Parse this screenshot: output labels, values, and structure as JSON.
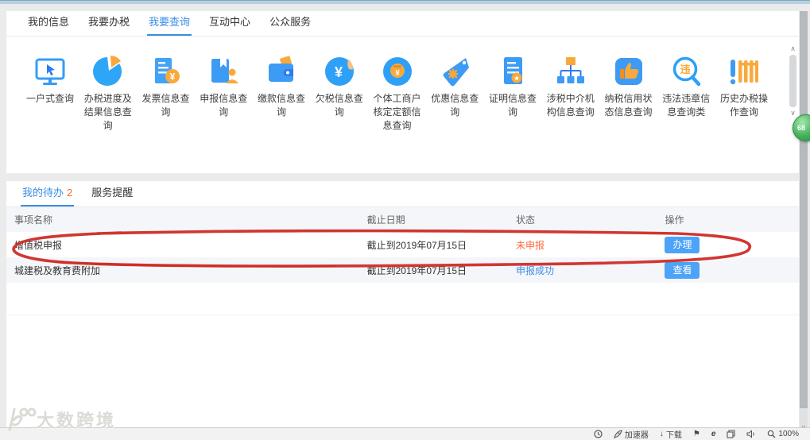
{
  "nav": {
    "tabs": [
      {
        "label": "我的信息"
      },
      {
        "label": "我要办税"
      },
      {
        "label": "我要查询"
      },
      {
        "label": "互动中心"
      },
      {
        "label": "公众服务"
      }
    ],
    "active_tab": "我要查询",
    "active_color": "#3a8ee6"
  },
  "query_icons": {
    "items": [
      {
        "label": "一户式查询",
        "icon": "monitor-cursor-icon"
      },
      {
        "label": "办税进度及结果信息查询",
        "icon": "pie-chart-icon"
      },
      {
        "label": "发票信息查询",
        "icon": "invoice-coin-icon"
      },
      {
        "label": "申报信息查询",
        "icon": "book-person-icon"
      },
      {
        "label": "缴款信息查询",
        "icon": "wallet-icon"
      },
      {
        "label": "欠税信息查询",
        "icon": "yuan-circle-icon"
      },
      {
        "label": "个体工商户核定定额信息查询",
        "icon": "coin-slot-icon"
      },
      {
        "label": "优惠信息查询",
        "icon": "discount-tag-icon"
      },
      {
        "label": "证明信息查询",
        "icon": "certificate-icon"
      },
      {
        "label": "涉税中介机构信息查询",
        "icon": "org-chart-icon"
      },
      {
        "label": "纳税信用状态信息查询",
        "icon": "thumbs-up-icon"
      },
      {
        "label": "违法违章信息查询类",
        "icon": "violation-search-icon"
      },
      {
        "label": "历史办税操作查询",
        "icon": "history-fence-icon"
      }
    ]
  },
  "todo": {
    "tabs": [
      {
        "label": "我的待办",
        "badge": "2"
      },
      {
        "label": "服务提醒",
        "badge": ""
      }
    ],
    "active_tab": "我的待办",
    "table": {
      "headers": [
        "事项名称",
        "截止日期",
        "状态",
        "操作"
      ],
      "rows": [
        {
          "name": "增值税申报",
          "deadline": "截止到2019年07月15日",
          "status": "未申报",
          "status_color": "#ff6c3e",
          "action": "办理"
        },
        {
          "name": "城建税及教育费附加",
          "deadline": "截止到2019年07月15日",
          "status": "申报成功",
          "status_color": "#3a8ee6",
          "action": "查看"
        }
      ]
    }
  },
  "annotation": {
    "shape": "hand-drawn-ellipse",
    "color": "#cf2b26",
    "target_row": "增值税申报"
  },
  "floating_badge": {
    "text": "68",
    "color": "#3fae54"
  },
  "watermark": {
    "text": "大数跨境"
  },
  "statusbar": {
    "accelerator_label": "加速器",
    "download_label": "下载",
    "ie_label": "e",
    "zoom_level": "100%"
  },
  "colors": {
    "accent_blue": "#3a8ee6",
    "icon_blue": "#349cf7",
    "icon_orange": "#f9a93c",
    "button_blue": "#4da3f8",
    "pending_red": "#ff6c3e"
  }
}
